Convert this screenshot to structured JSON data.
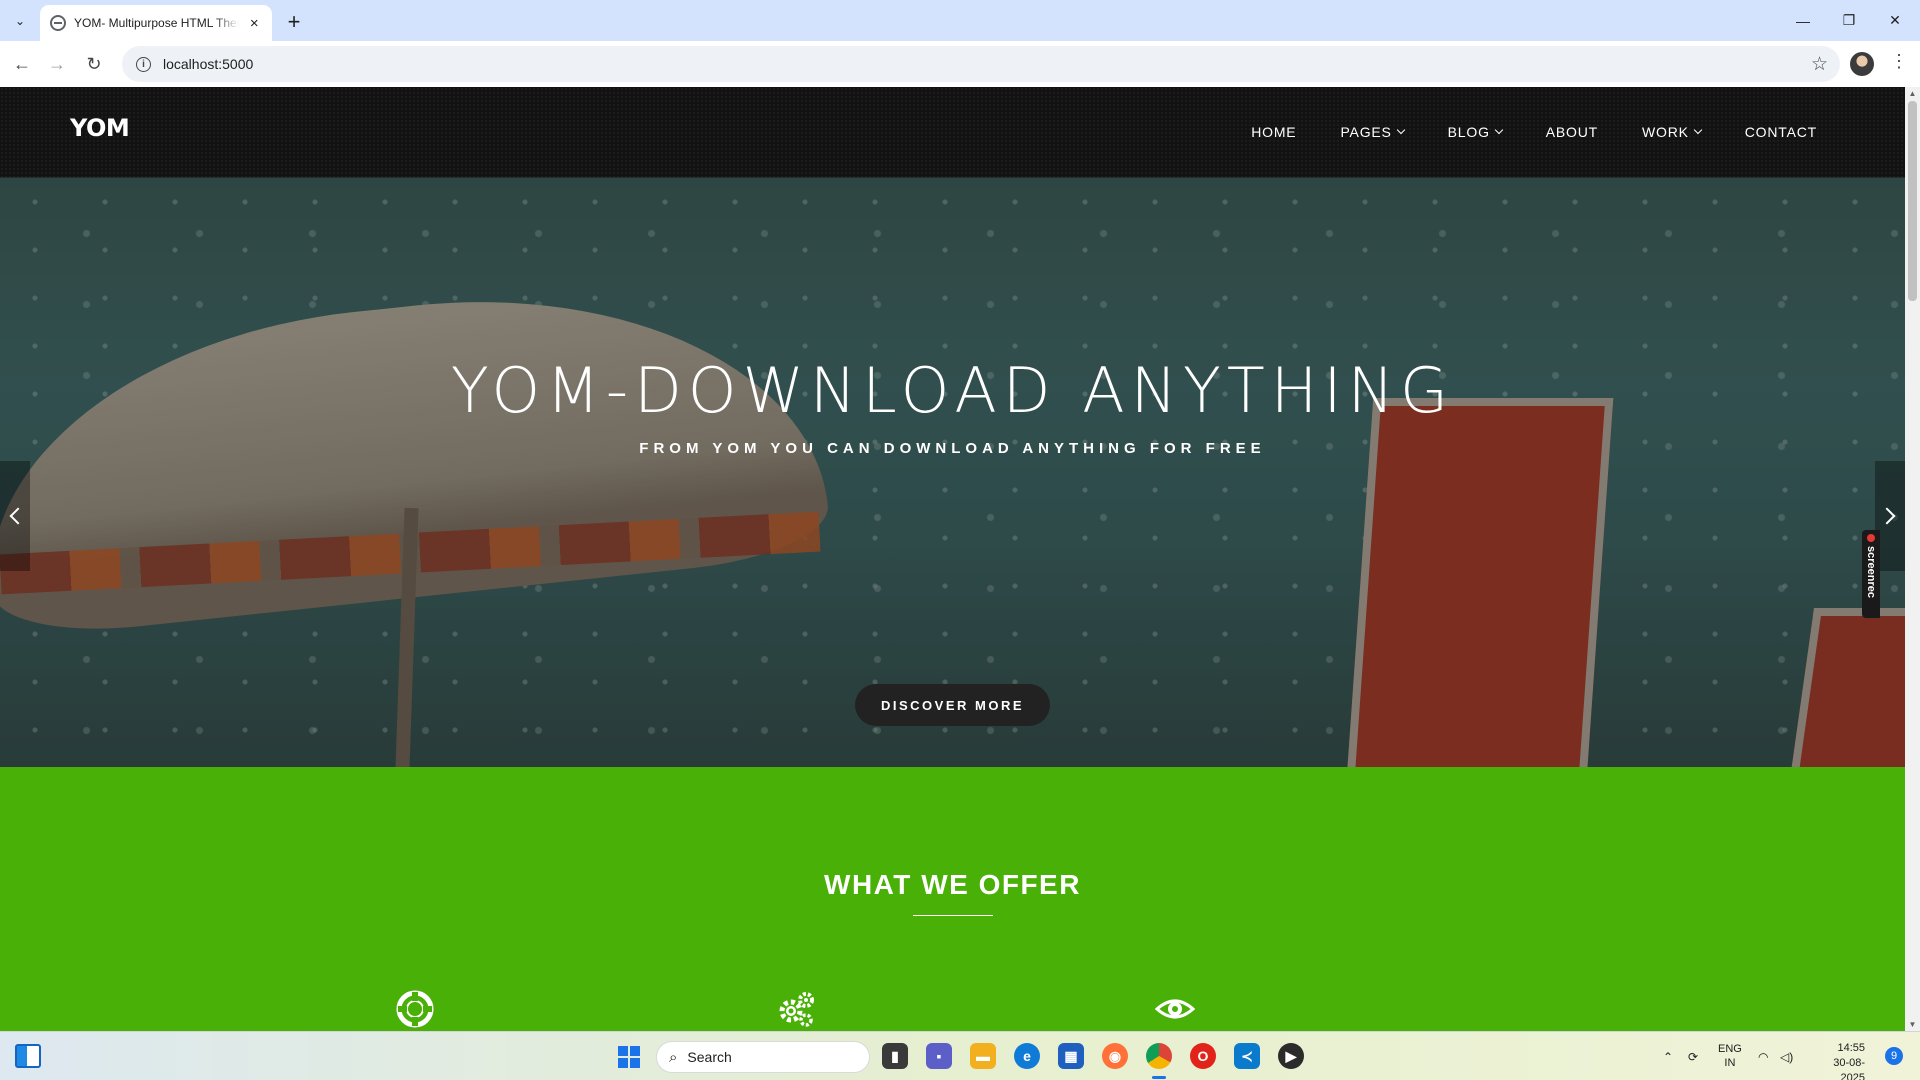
{
  "browser": {
    "tab_title": "YOM- Multipurpose HTML Theme",
    "url": "localhost:5000",
    "new_tab_symbol": "+",
    "close_symbol": "×"
  },
  "site": {
    "logo": "YOM",
    "menu": [
      {
        "label": "HOME",
        "dropdown": false
      },
      {
        "label": "PAGES",
        "dropdown": true
      },
      {
        "label": "BLOG",
        "dropdown": true
      },
      {
        "label": "ABOUT",
        "dropdown": false
      },
      {
        "label": "WORK",
        "dropdown": true
      },
      {
        "label": "CONTACT",
        "dropdown": false
      }
    ],
    "hero": {
      "title": "YOM-DOWNLOAD ANYTHING",
      "subtitle": "FROM YOM YOU CAN DOWNLOAD ANYTHING FOR FREE",
      "button": "DISCOVER MORE"
    },
    "offer": {
      "title": "WHAT WE OFFER",
      "icons": [
        "lifebuoy-icon",
        "gears-icon",
        "eye-icon"
      ]
    },
    "colors": {
      "header_bg": "#121212",
      "offer_bg": "#48b006",
      "button_bg": "#222222"
    }
  },
  "overlay": {
    "screenrec_label": "screenrec"
  },
  "taskbar": {
    "search_placeholder": "Search",
    "lang_top": "ENG",
    "lang_bottom": "IN",
    "time": "14:55",
    "date": "30-08-2025",
    "notification_count": "9"
  }
}
